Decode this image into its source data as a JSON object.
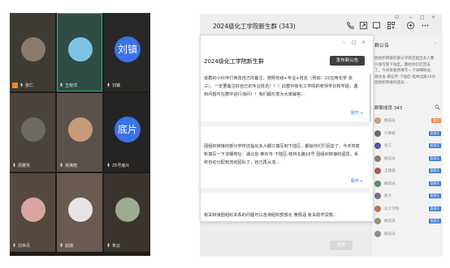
{
  "video_call": {
    "participants": [
      {
        "name": "张仁",
        "avatar_type": "photo",
        "avatar_color": "#8a7c6c",
        "is_host": true,
        "is_active": false,
        "avatar_text": ""
      },
      {
        "name": "王晓洋",
        "avatar_type": "photo",
        "avatar_color": "#7ec3e6",
        "is_host": false,
        "is_active": true,
        "avatar_text": ""
      },
      {
        "name": "刘镇",
        "avatar_type": "text",
        "avatar_color": "#3a72e8",
        "is_host": false,
        "is_active": false,
        "avatar_text": "刘镇"
      },
      {
        "name": "周雅琴",
        "avatar_type": "photo",
        "avatar_color": "#6d6a64",
        "is_host": false,
        "is_active": false,
        "avatar_text": ""
      },
      {
        "name": "常满丽",
        "avatar_type": "photo",
        "avatar_color": "#c79a7c",
        "is_host": false,
        "is_active": false,
        "avatar_text": ""
      },
      {
        "name": "25号底片",
        "avatar_type": "text",
        "avatar_color": "#3a72e8",
        "is_host": false,
        "is_active": false,
        "avatar_text": "底片"
      },
      {
        "name": "刘世丹",
        "avatar_type": "photo",
        "avatar_color": "#d7a6a0",
        "is_host": false,
        "is_active": false,
        "avatar_text": ""
      },
      {
        "name": "赵婧",
        "avatar_type": "photo",
        "avatar_color": "#e8e4e6",
        "is_host": false,
        "is_active": false,
        "avatar_text": ""
      },
      {
        "name": "朱云",
        "avatar_type": "photo",
        "avatar_color": "#9cab92",
        "is_host": false,
        "is_active": false,
        "avatar_text": ""
      }
    ]
  },
  "chat": {
    "title": "2024级化工学院新生群 (343)",
    "toolbar_icons": [
      "phone-icon",
      "screen-share-icon",
      "video-icon",
      "apps-icon",
      "add-icon",
      "more-icon"
    ],
    "window_controls": [
      "⊡",
      "−",
      "□",
      "×"
    ],
    "announcement": {
      "title": "2024级化工学院新生群",
      "publish_button": "发布新公告",
      "items": [
        {
          "text": "进群的小伙伴们修改自己的备注，按照年级+专业+姓名（例如：22应用化学 张三），一定要备注好自己的专业姓名！！！此群中有化工学院的老师学长和学姐，遇到问题可在群中进行询问！！我们都乐意为大家解答...",
          "expand_label": "展开 ∨"
        },
        {
          "text": "团组织转接的部分学校还提出多人都只填写到下陆区，都给你们打回去了，今天恢复新填写一下详细地址：湖北省-黄石市-下陆区-桂林北路16号 团组织转接的团员，系统自动分配到流动团队了，自己再从流...",
          "expand_label": "展开 ∨"
        },
        {
          "text": "有关转接团组织关系的问题可以咨询组织部部长 黄佩涵 有关助学贷款...",
          "expand_label": ""
        }
      ]
    },
    "sidebar": {
      "announcement_label": "群公告",
      "announcement_snippet": "团组织转接的部分学校还提出多人都只填写到下陆区，都给你们打回去了，今天恢复新填写一下详细地址：湖北省-黄石市-下陆区-桂林北路16号 团组织转接的团员...",
      "members_label": "群聊成员 343",
      "members": [
        {
          "name": "群成员",
          "badge": "群主",
          "badge_type": "owner",
          "color": "#c9a07e"
        },
        {
          "name": "计算机",
          "badge": "管理员",
          "badge_type": "admin",
          "color": "#6b6b6b"
        },
        {
          "name": "化工",
          "badge": "管理员",
          "badge_type": "admin",
          "color": "#4a58b0"
        },
        {
          "name": "群成员",
          "badge": "管理员",
          "badge_type": "admin",
          "color": "#8c7a6e"
        },
        {
          "name": "王建楚",
          "badge": "管理员",
          "badge_type": "admin",
          "color": "#b65a4e"
        },
        {
          "name": "群成员",
          "badge": "管理员",
          "badge_type": "admin",
          "color": "#5f8a6a"
        },
        {
          "name": "赵大",
          "badge": "管理员",
          "badge_type": "admin",
          "color": "#7b6f8a"
        },
        {
          "name": "化工学院",
          "badge": "管理员",
          "badge_type": "admin",
          "color": "#c46d4f"
        },
        {
          "name": "群成员",
          "badge": "管理员",
          "badge_type": "admin",
          "color": "#9a8f7c"
        },
        {
          "name": "群成员",
          "badge": "",
          "badge_type": "",
          "color": "#8a8a8a"
        }
      ]
    },
    "composer": {
      "send_label": "发送"
    },
    "colors": {
      "link": "#2f7fe8",
      "admin_badge": "#3a7bd5",
      "owner_badge": "#ee8a4a"
    }
  }
}
